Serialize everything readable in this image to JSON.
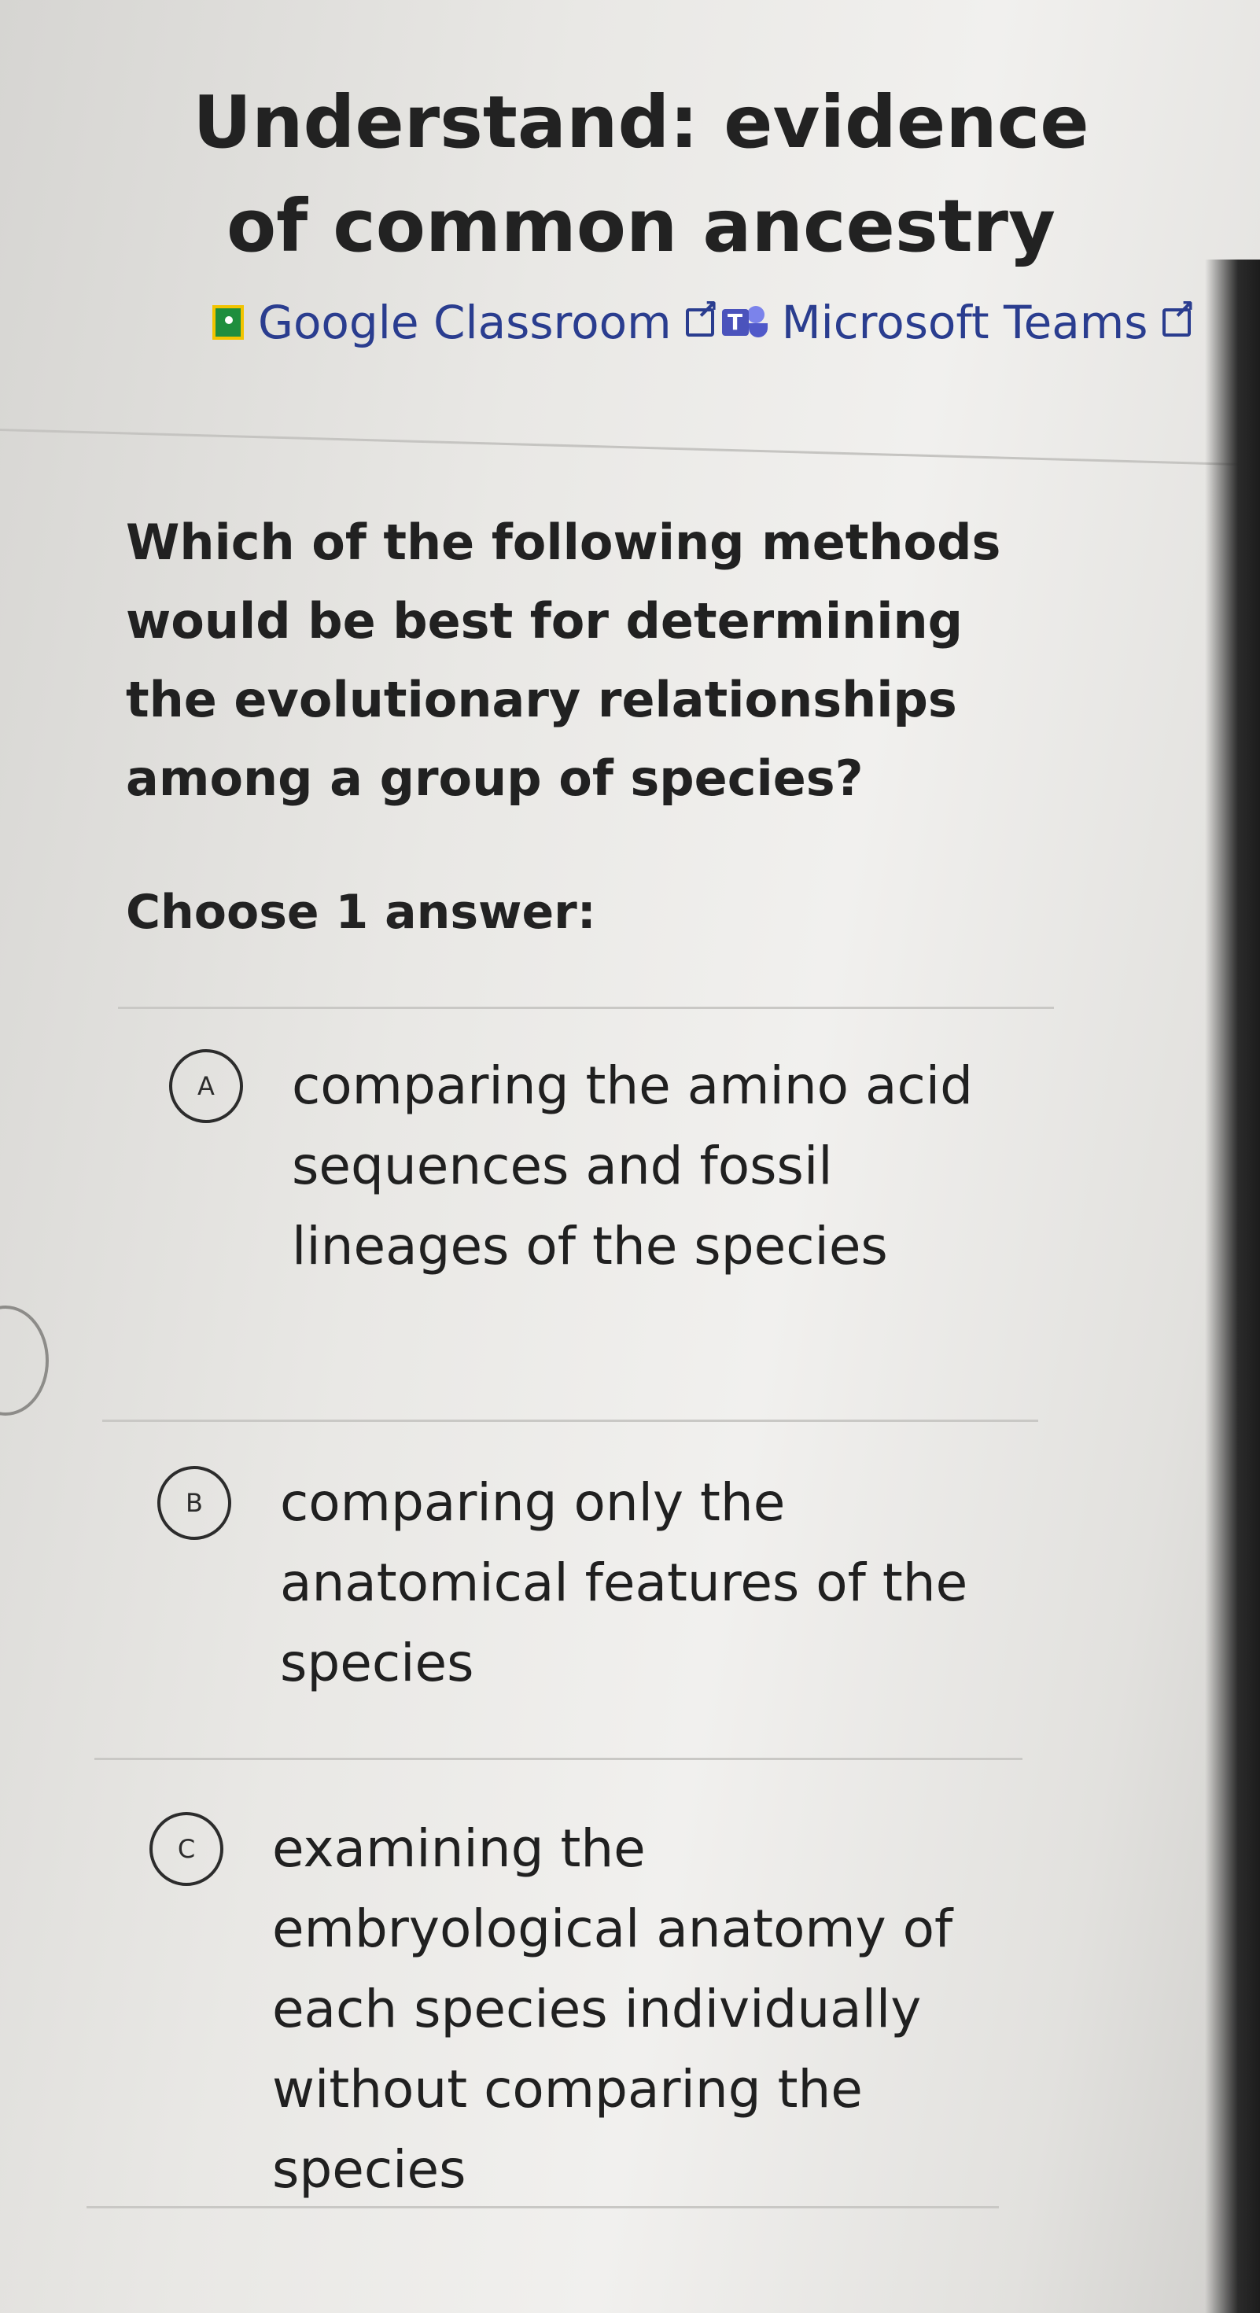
{
  "header": {
    "title": "Understand: evidence of common ancestry"
  },
  "share": {
    "google_classroom": "Google Classroom",
    "microsoft_teams": "Microsoft Teams"
  },
  "question": {
    "text": "Which of the following methods would be best for determining the evolutionary relationships among a group of species?",
    "instruction": "Choose 1 answer:"
  },
  "choices": [
    {
      "letter": "A",
      "text": "comparing the amino acid sequences and fossil lineages of the species"
    },
    {
      "letter": "B",
      "text": "comparing only the anatomical features of the species"
    },
    {
      "letter": "C",
      "text": "examining the embryological anatomy of each species individually without comparing the species"
    }
  ],
  "colors": {
    "link": "#2a3d8f",
    "google_classroom_icon": "#1e8e3e",
    "teams_icon": "#4b53bc"
  }
}
